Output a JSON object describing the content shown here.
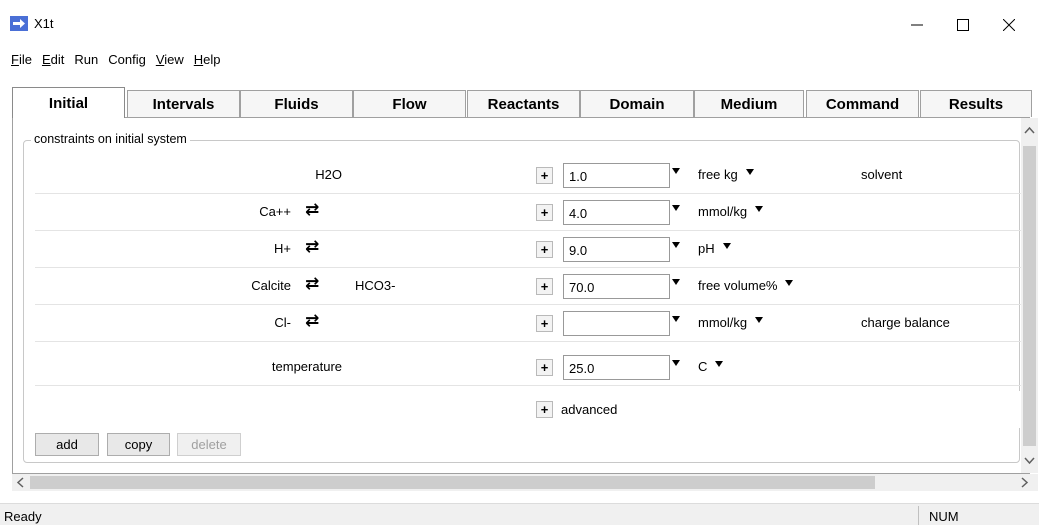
{
  "window": {
    "title": "X1t",
    "icon": "arrow-right-icon"
  },
  "menu": {
    "items": [
      {
        "label": "File",
        "underline": "F",
        "rest": "ile"
      },
      {
        "label": "Edit",
        "underline": "E",
        "rest": "dit"
      },
      {
        "label": "Run",
        "underline": "",
        "rest": "Run"
      },
      {
        "label": "Config",
        "underline": "",
        "rest": "Config"
      },
      {
        "label": "View",
        "underline": "V",
        "rest": "iew"
      },
      {
        "label": "Help",
        "underline": "H",
        "rest": "elp"
      }
    ]
  },
  "tabs": [
    "Initial",
    "Intervals",
    "Fluids",
    "Flow",
    "Reactants",
    "Domain",
    "Medium",
    "Command",
    "Results"
  ],
  "active_tab": "Initial",
  "group_title": "constraints on initial system",
  "rows": [
    {
      "species": "H2O",
      "swap": "",
      "swapped": "",
      "value": "1.0",
      "unit": "free kg",
      "note": "solvent"
    },
    {
      "species": "Ca++",
      "swap": "⇄",
      "swapped": "",
      "value": "4.0",
      "unit": "mmol/kg",
      "note": ""
    },
    {
      "species": "H+",
      "swap": "⇄",
      "swapped": "",
      "value": "9.0",
      "unit": "pH",
      "note": ""
    },
    {
      "species": "Calcite",
      "swap": "⇄",
      "swapped": "HCO3-",
      "value": "70.0",
      "unit": "free volume%",
      "note": ""
    },
    {
      "species": "Cl-",
      "swap": "⇄",
      "swapped": "",
      "value": "",
      "unit": "mmol/kg",
      "note": "charge balance"
    },
    {
      "species": "temperature",
      "swap": "",
      "swapped": "",
      "value": "25.0",
      "unit": "C",
      "note": ""
    }
  ],
  "advanced": {
    "plus": "+",
    "label": "advanced"
  },
  "plus_label": "+",
  "buttons": {
    "add": "add",
    "copy": "copy",
    "delete": "delete"
  },
  "status": {
    "text": "Ready",
    "num": "NUM"
  }
}
